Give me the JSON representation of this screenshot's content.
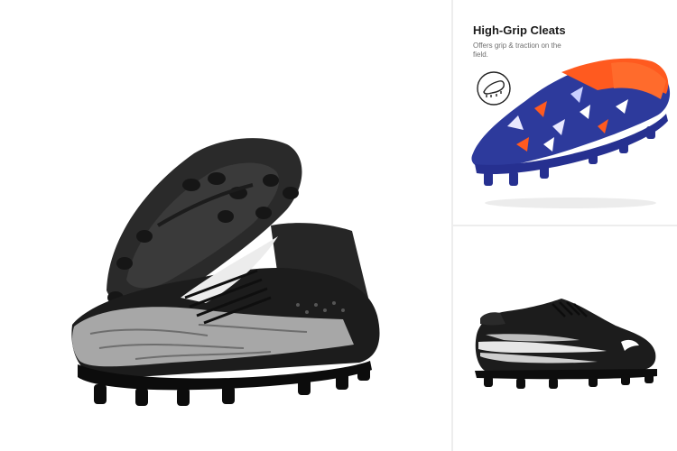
{
  "feature": {
    "title": "High-Grip Cleats",
    "description": "Offers grip & traction on the field.",
    "icon": "cleat-outline-icon"
  },
  "images": {
    "hero": "black-grey-high-top-cleats-pair",
    "top_right": "blue-orange-cleat",
    "bottom_right": "black-white-low-cleat"
  },
  "colors": {
    "background": "#ffffff",
    "divider": "#ededed",
    "title": "#1a1a1a",
    "description": "#6f6f6f"
  }
}
